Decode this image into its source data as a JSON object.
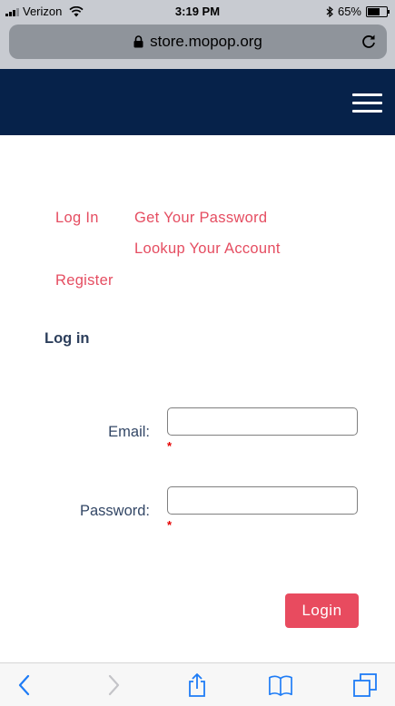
{
  "status_bar": {
    "carrier": "Verizon",
    "time": "3:19 PM",
    "battery": "65%",
    "battery_level": 0.65
  },
  "browser": {
    "url": "store.mopop.org"
  },
  "colors": {
    "header": "#06224a",
    "link": "#e54d61",
    "button": "#e84b5f",
    "required": "#e60000",
    "ios_blue": "#1e7cf6"
  },
  "account_links": {
    "login": "Log In",
    "get_password": "Get Your Password",
    "lookup_account": "Lookup Your Account",
    "register": "Register"
  },
  "form": {
    "title": "Log in",
    "email_label": "Email:",
    "email_value": "",
    "password_label": "Password:",
    "password_value": "",
    "required_marker": "*",
    "submit_label": "Login"
  },
  "icons": {
    "signal": "signal-bars-icon",
    "wifi": "wifi-icon",
    "bluetooth": "bluetooth-icon",
    "battery": "battery-icon",
    "lock": "lock-icon",
    "reload": "reload-icon",
    "menu": "hamburger-menu-icon",
    "back": "back-arrow-icon",
    "forward": "forward-arrow-icon",
    "share": "share-icon",
    "bookmarks": "bookmarks-icon",
    "tabs": "tabs-icon"
  }
}
